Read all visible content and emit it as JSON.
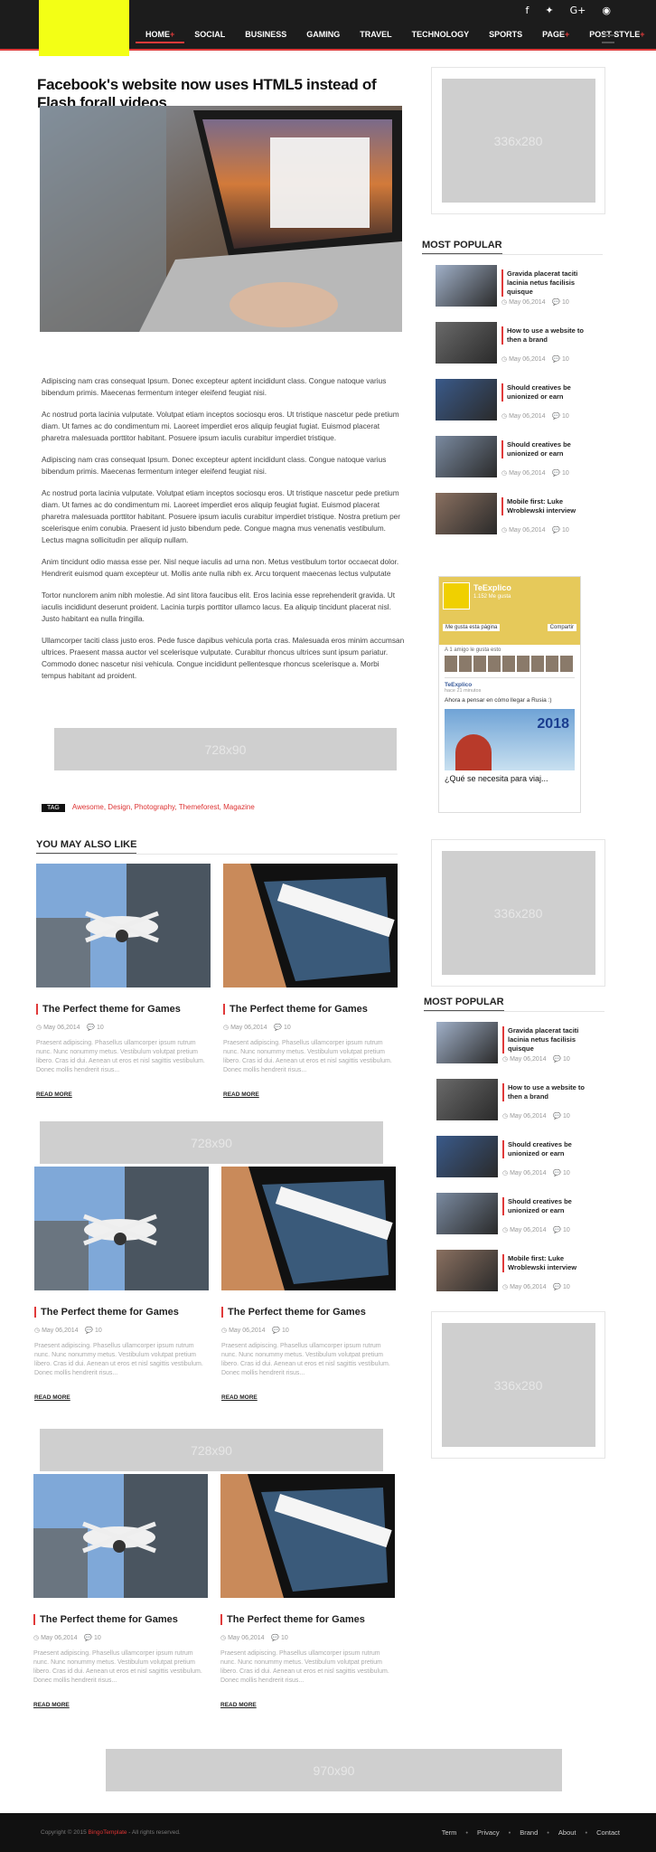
{
  "nav": {
    "items": [
      "HOME",
      "SOCIAL",
      "BUSINESS",
      "GAMING",
      "TRAVEL",
      "TECHNOLOGY",
      "SPORTS",
      "PAGE",
      "POST STYLE"
    ]
  },
  "social_icons": [
    "facebook-icon",
    "twitter-icon",
    "google-plus-icon",
    "rss-icon"
  ],
  "post": {
    "title": "Facebook's website now uses HTML5 instead of Flash forall videos",
    "paragraphs": [
      "Adipiscing nam cras consequat Ipsum. Donec excepteur aptent incididunt class. Congue natoque varius bibendum primis. Maecenas fermentum integer eleifend feugiat nisi.",
      "Ac nostrud porta lacinia vulputate. Volutpat etiam inceptos sociosqu eros. Ut tristique nascetur pede pretium diam. Ut fames ac do condimentum mi. Laoreet imperdiet eros aliquip feugiat fugiat. Euismod placerat pharetra malesuada porttitor habitant. Posuere ipsum iaculis curabitur imperdiet tristique.",
      "Adipiscing nam cras consequat Ipsum. Donec excepteur aptent incididunt class. Congue natoque varius bibendum primis. Maecenas fermentum integer eleifend feugiat nisi.",
      "Ac nostrud porta lacinia vulputate. Volutpat etiam inceptos sociosqu eros. Ut tristique nascetur pede pretium diam. Ut fames ac do condimentum mi. Laoreet imperdiet eros aliquip feugiat fugiat. Euismod placerat pharetra malesuada porttitor habitant. Posuere ipsum iaculis curabitur imperdiet tristique. Nostra pretium per scelerisque enim conubia. Praesent id justo bibendum pede. Congue magna mus venenatis vestibulum. Lectus magna sollicitudin per aliquip nullam.",
      "Anim tincidunt odio massa esse per. Nisl neque iaculis ad urna non. Metus vestibulum tortor occaecat dolor. Hendrerit euismod quam excepteur ut. Mollis ante nulla nibh ex. Arcu torquent maecenas lectus vulputate",
      "Tortor nunclorem anim nibh molestie. Ad sint litora faucibus elit. Eros lacinia esse reprehenderit gravida. Ut iaculis incididunt deserunt proident. Lacinia turpis porttitor ullamco lacus. Ea aliquip tincidunt placerat nisl. Justo habitant ea nulla fringilla.",
      "Ullamcorper taciti class justo eros. Pede fusce dapibus vehicula porta cras. Malesuada eros minim accumsan ultrices. Praesent massa auctor vel scelerisque vulputate. Curabitur rhoncus ultrices sunt ipsum pariatur. Commodo donec nascetur nisi vehicula. Congue incididunt pellentesque rhoncus scelerisque a. Morbi tempus habitant ad proident."
    ],
    "ad_label": "728x90"
  },
  "tags": {
    "label": "TAG",
    "list": "Awesome, Design, Photography, Themeforest, Magazine"
  },
  "may_like": {
    "title": "YOU MAY ALSO LIKE",
    "card": {
      "title": "The Perfect theme for Games",
      "date": "May 06,2014",
      "comments": "10",
      "desc": "Praesent adipiscing. Phasellus ullamcorper ipsum rutrum nunc. Nunc nonummy metus. Vestibulum volutpat pretium libero. Cras id dui. Aenean ut eros et nisl sagittis vestibulum. Donec mollis hendrerit risus...",
      "read_more": "READ MORE"
    },
    "ad_label": "728x90"
  },
  "sidebar": {
    "ad_label": "336x280",
    "popular_title": "MOST POPULAR",
    "popular": [
      {
        "title": "Gravida placerat taciti lacinia netus facilisis quisque",
        "date": "May 06,2014",
        "comments": "10"
      },
      {
        "title": "How to use a website to then a brand",
        "date": "May 06,2014",
        "comments": "10"
      },
      {
        "title": "Should creatives be unionized or earn",
        "date": "May 06,2014",
        "comments": "10"
      },
      {
        "title": "Should creatives be unionized or earn",
        "date": "May 06,2014",
        "comments": "10"
      },
      {
        "title": "Mobile first: Luke Wroblewski interview",
        "date": "May 06,2014",
        "comments": "10"
      }
    ],
    "fb": {
      "page": "TeExplico",
      "likes": "1.152 Me gusta",
      "like_btn": "Me gusta esta página",
      "share": "Compartir",
      "friend": "A 1 amigo le gusta esto",
      "post_page": "TeExplico",
      "post_time": "hace 21 minutos",
      "post_text": "Ahora a pensar en cómo llegar a Rusia :)",
      "year": "2018",
      "headline": "¿Qué se necesita para viaj..."
    }
  },
  "footer_ad": "970x90",
  "footer": {
    "copyright": "Copyright © 2015",
    "brand": "BingoTemplate",
    "rights": " - All rights reserved.",
    "links": [
      "Term",
      "Privacy",
      "Brand",
      "About",
      "Contact"
    ]
  }
}
